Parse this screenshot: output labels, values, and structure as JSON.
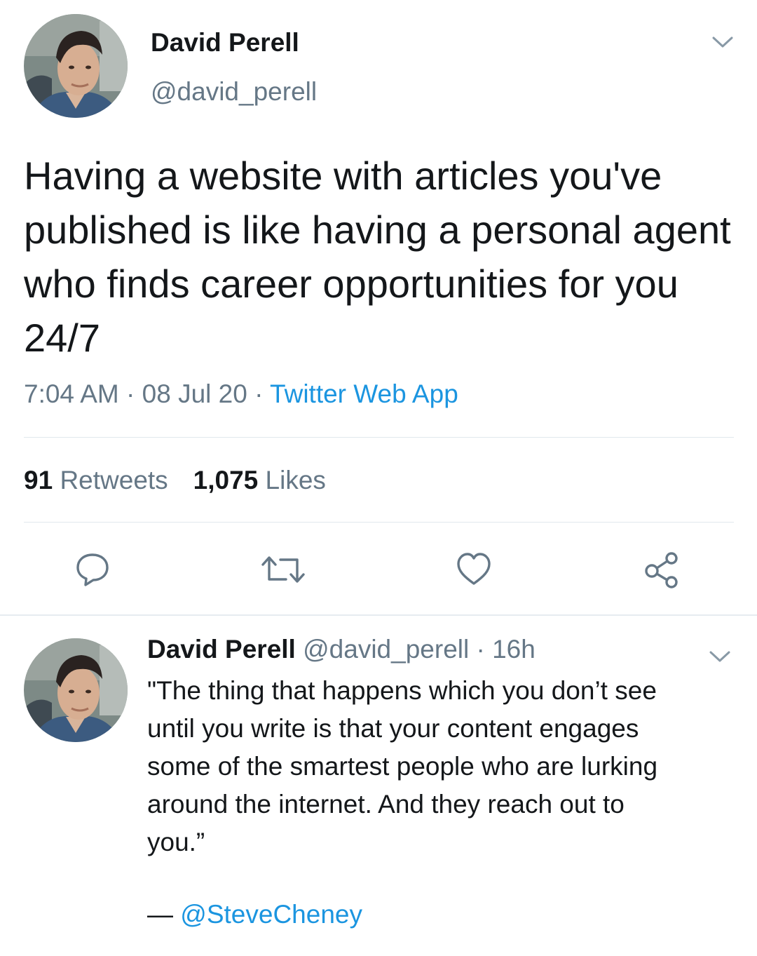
{
  "main_tweet": {
    "author": {
      "display_name": "David Perell",
      "handle": "@david_perell"
    },
    "text": "Having a website with articles you've published is like having a personal agent who finds career opportunities for you 24/7",
    "time": "7:04 AM",
    "separator": " · ",
    "date": "08 Jul 20",
    "source": "Twitter Web App",
    "retweet_count": "91",
    "retweet_label": "Retweets",
    "like_count": "1,075",
    "like_label": "Likes",
    "actions": [
      "reply-icon",
      "retweet-icon",
      "like-icon",
      "share-icon"
    ]
  },
  "reply_tweet": {
    "display_name": "David Perell",
    "handle": "@david_perell",
    "separator": " · ",
    "time_ago": "16h",
    "text_lines": [
      "\"The thing that happens which you don’t see",
      "until you write is that your content engages",
      "some of the smartest people who are lurking",
      "around the internet. And they reach out to",
      "you.”"
    ],
    "signature_dash": "— ",
    "signature_handle": "@SteveCheney"
  },
  "colors": {
    "text": "#14171a",
    "secondary": "#657786",
    "link": "#1b95e0",
    "divider": "#e1e8ed"
  }
}
